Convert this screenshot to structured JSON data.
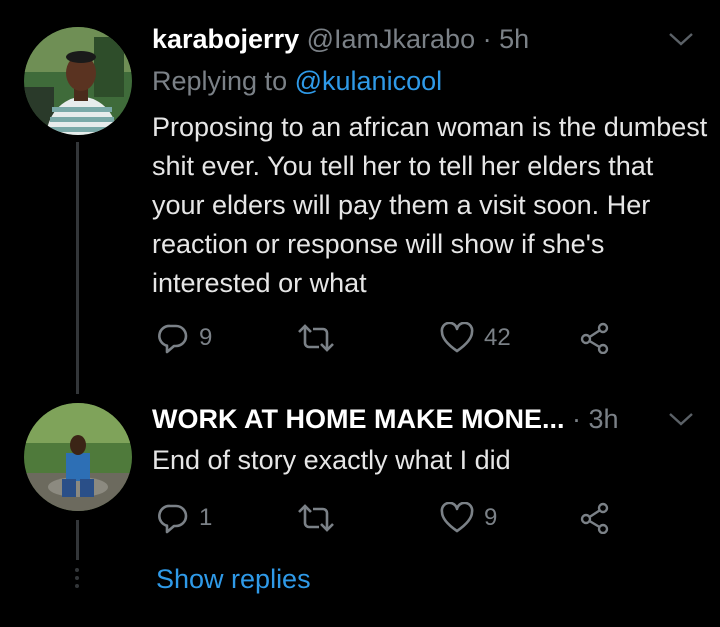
{
  "tweets": [
    {
      "name": "karabojerry",
      "handle": "@IamJkarabo",
      "time": "5h",
      "replying_prefix": "Replying to",
      "replying_to": "@kulanicool",
      "text": "Proposing to an african woman is the dumbest shit ever. You tell her to tell her elders that your elders will pay them a visit soon. Her reaction or response will show if she's interested or what",
      "replies": "9",
      "likes": "42"
    },
    {
      "name": "WORK AT HOME MAKE MONE...",
      "time": "3h",
      "text": "End of story exactly what I did",
      "replies": "1",
      "likes": "9"
    }
  ],
  "show_replies": "Show replies",
  "icons": [
    "reply-icon",
    "retweet-icon",
    "like-icon",
    "share-icon",
    "chevron-down-icon"
  ],
  "colors": {
    "background": "#000000",
    "link": "#2f9ae8",
    "muted": "#7b8187",
    "text": "#e6e6e6"
  }
}
